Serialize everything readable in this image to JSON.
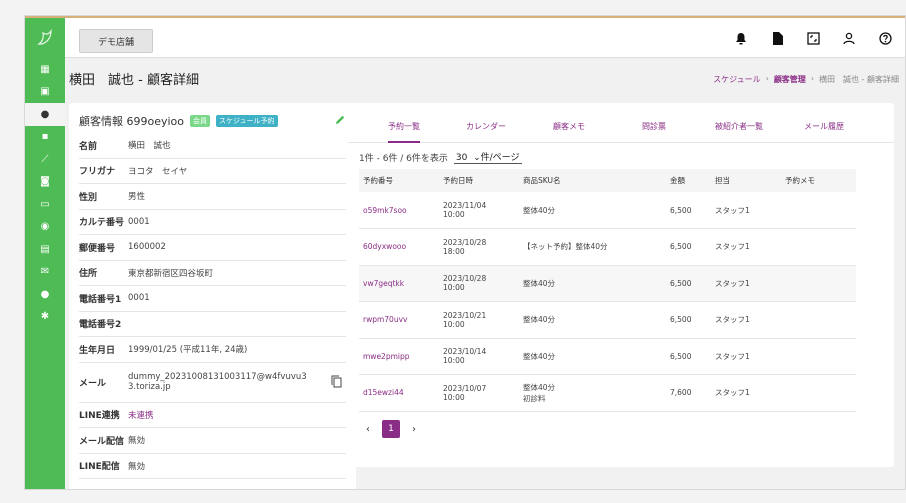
{
  "header": {
    "store_button": "デモ店舗",
    "icons": [
      "bell-icon",
      "document-icon",
      "expand-icon",
      "user-icon",
      "help-icon"
    ]
  },
  "sidebar": {
    "items": [
      "dashboard-icon",
      "calendar-icon",
      "customer-icon",
      "badge-icon",
      "chart-icon",
      "shop-icon",
      "card-icon",
      "palette-icon",
      "store-icon",
      "mail-icon",
      "chat-icon",
      "settings-icon"
    ],
    "active_index": 2
  },
  "page": {
    "title": "横田　誠也 - 顧客詳細",
    "breadcrumb": [
      "スケジュール",
      "›",
      "顧客管理",
      "›",
      "横田　誠也 - 顧客詳細"
    ]
  },
  "customer": {
    "heading": "顧客情報 699oeyioo",
    "badge_member": "会員",
    "badge_schedule": "スケジュール予約",
    "fields": [
      {
        "label": "名前",
        "value": "横田　誠也"
      },
      {
        "label": "フリガナ",
        "value": "ヨコタ　セイヤ"
      },
      {
        "label": "性別",
        "value": "男性"
      },
      {
        "label": "カルテ番号",
        "value": "0001"
      },
      {
        "label": "郵便番号",
        "value": "1600002"
      },
      {
        "label": "住所",
        "value": "東京都新宿区四谷坂町"
      },
      {
        "label": "電話番号1",
        "value": "0001"
      },
      {
        "label": "電話番号2",
        "value": ""
      },
      {
        "label": "生年月日",
        "value": "1999/01/25 (平成11年, 24歳)"
      },
      {
        "label": "メール",
        "value": "dummy_20231008131003117@w4fvuvu3",
        "value2": "3.toriza.jp"
      },
      {
        "label": "LINE連携",
        "value": "未連携"
      },
      {
        "label": "メール配信",
        "value": "無効"
      },
      {
        "label": "LINE配信",
        "value": "無効"
      }
    ]
  },
  "tabs": [
    "予約一覧",
    "カレンダー",
    "顧客メモ",
    "問診票",
    "被紹介者一覧",
    "メール履歴"
  ],
  "list": {
    "count_text": "1件 - 6件 / 6件を表示",
    "per_page_value": "30",
    "per_page_suffix": "件/ページ",
    "columns": [
      "予約番号",
      "予約日時",
      "商品SKU名",
      "金額",
      "担当",
      "予約メモ"
    ],
    "rows": [
      {
        "id": "o59mk7soo",
        "date": "2023/11/04",
        "time": "10:00",
        "sku": "整体40分",
        "sku2": "",
        "amount": "6,500",
        "staff": "スタッフ1",
        "memo": ""
      },
      {
        "id": "60dyxwooo",
        "date": "2023/10/28",
        "time": "18:00",
        "sku": "【ネット予約】整体40分",
        "sku2": "",
        "amount": "6,500",
        "staff": "スタッフ1",
        "memo": ""
      },
      {
        "id": "vw7geqtkk",
        "date": "2023/10/28",
        "time": "10:00",
        "sku": "整体40分",
        "sku2": "",
        "amount": "6,500",
        "staff": "スタッフ1",
        "memo": ""
      },
      {
        "id": "rwpm70uvv",
        "date": "2023/10/21",
        "time": "10:00",
        "sku": "整体40分",
        "sku2": "",
        "amount": "6,500",
        "staff": "スタッフ1",
        "memo": ""
      },
      {
        "id": "mwe2pmipp",
        "date": "2023/10/14",
        "time": "10:00",
        "sku": "整体40分",
        "sku2": "",
        "amount": "6,500",
        "staff": "スタッフ1",
        "memo": ""
      },
      {
        "id": "d15ewzi44",
        "date": "2023/10/07",
        "time": "10:00",
        "sku": "整体40分",
        "sku2": "初診料",
        "amount": "7,600",
        "staff": "スタッフ1",
        "memo": ""
      }
    ]
  },
  "pager": {
    "prev": "‹",
    "current": "1",
    "next": "›"
  },
  "colors": {
    "accent": "#8a2d86",
    "sidebar": "#4fbb55"
  }
}
